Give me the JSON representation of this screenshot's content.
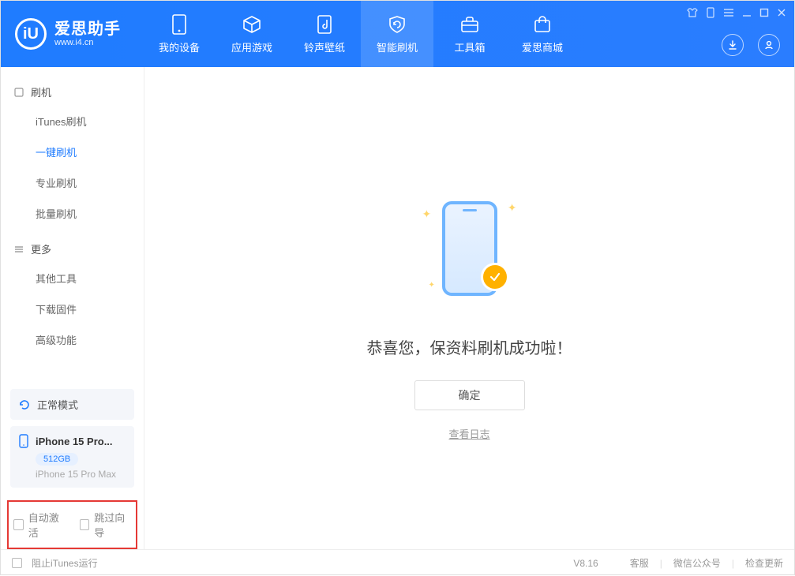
{
  "app": {
    "title": "爱思助手",
    "subtitle": "www.i4.cn",
    "logo_letter": "iU"
  },
  "nav": {
    "tabs": [
      {
        "label": "我的设备",
        "icon": "device-icon"
      },
      {
        "label": "应用游戏",
        "icon": "cube-icon"
      },
      {
        "label": "铃声壁纸",
        "icon": "music-icon"
      },
      {
        "label": "智能刷机",
        "icon": "refresh-shield-icon",
        "active": true
      },
      {
        "label": "工具箱",
        "icon": "toolbox-icon"
      },
      {
        "label": "爱思商城",
        "icon": "shop-icon"
      }
    ]
  },
  "sidebar": {
    "group1": {
      "title": "刷机",
      "items": [
        {
          "label": "iTunes刷机"
        },
        {
          "label": "一键刷机",
          "active": true
        },
        {
          "label": "专业刷机"
        },
        {
          "label": "批量刷机"
        }
      ]
    },
    "group2": {
      "title": "更多",
      "items": [
        {
          "label": "其他工具"
        },
        {
          "label": "下载固件"
        },
        {
          "label": "高级功能"
        }
      ]
    },
    "mode_label": "正常模式",
    "device": {
      "name": "iPhone 15 Pro...",
      "storage": "512GB",
      "model": "iPhone 15 Pro Max"
    },
    "checkboxes": {
      "auto_activate": "自动激活",
      "skip_guide": "跳过向导"
    }
  },
  "main": {
    "success_text": "恭喜您，保资料刷机成功啦！",
    "ok_button": "确定",
    "view_log": "查看日志"
  },
  "footer": {
    "block_itunes": "阻止iTunes运行",
    "version": "V8.16",
    "links": {
      "support": "客服",
      "wechat": "微信公众号",
      "update": "检查更新"
    }
  }
}
